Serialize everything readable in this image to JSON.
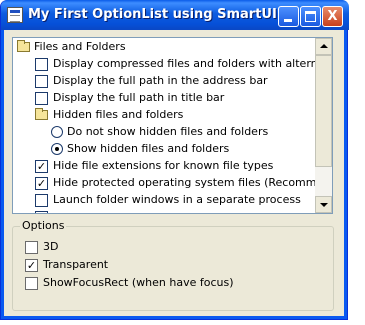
{
  "window": {
    "title": "My First OptionList using SmartUI",
    "buttons": {
      "minimize": "minimize",
      "maximize": "maximize",
      "close": "X"
    }
  },
  "list": {
    "items": [
      {
        "type": "folder",
        "label": "Files and Folders"
      },
      {
        "type": "checkbox",
        "label": "Display compressed files and folders with alternate color",
        "checked": false
      },
      {
        "type": "checkbox",
        "label": "Display the full path in the address bar",
        "checked": false
      },
      {
        "type": "checkbox",
        "label": "Display the full path in title bar",
        "checked": false
      },
      {
        "type": "folder",
        "label": "Hidden files and folders"
      },
      {
        "type": "radio",
        "label": "Do not show hidden files and folders",
        "selected": false
      },
      {
        "type": "radio",
        "label": "Show hidden files and folders",
        "selected": true
      },
      {
        "type": "checkbox",
        "label": "Hide file extensions for known file types",
        "checked": true
      },
      {
        "type": "checkbox",
        "label": "Hide protected operating system files (Recommended)",
        "checked": true
      },
      {
        "type": "checkbox",
        "label": "Launch folder windows in a separate process",
        "checked": false
      }
    ]
  },
  "options": {
    "legend": "Options",
    "items": [
      {
        "label": "3D",
        "checked": false
      },
      {
        "label": "Transparent",
        "checked": true
      },
      {
        "label": "ShowFocusRect (when have focus)",
        "checked": false
      }
    ]
  },
  "colors": {
    "titlebar": "#0a5ce8",
    "window_face": "#ece9d8",
    "close_button": "#d3553a"
  }
}
